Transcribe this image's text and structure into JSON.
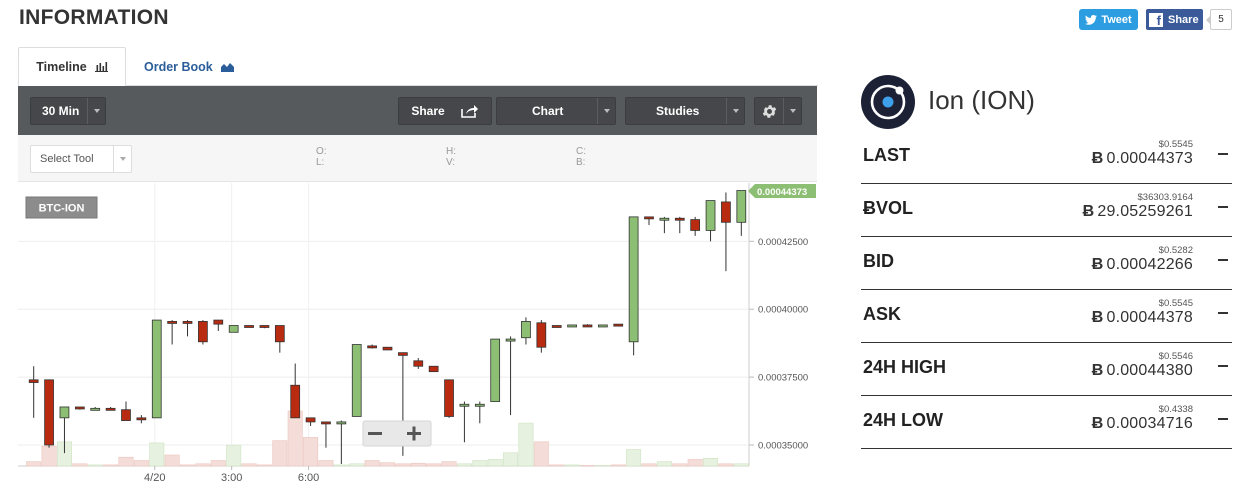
{
  "header": {
    "title": "INFORMATION"
  },
  "social": {
    "tweet_label": "Tweet",
    "share_label": "Share",
    "share_count": "5"
  },
  "tabs": [
    {
      "label": "Timeline",
      "icon": "bar-chart-icon",
      "active": true
    },
    {
      "label": "Order Book",
      "icon": "area-chart-icon",
      "active": false
    }
  ],
  "toolbar": {
    "interval": "30 Min",
    "share": "Share",
    "chart": "Chart",
    "studies": "Studies"
  },
  "tools": {
    "select_tool": "Select Tool",
    "ohlc_labels": [
      "O:",
      "L:",
      "H:",
      "V:",
      "C:",
      "B:"
    ]
  },
  "chart_data": {
    "type": "candlestick",
    "pair_label": "BTC-ION",
    "last_price_label": "0.00044373",
    "y_ticks": [
      "0.00042500",
      "0.00040000",
      "0.00037500",
      "0.00035000"
    ],
    "x_ticks": [
      "4/20",
      "3:00",
      "6:00"
    ],
    "ylim": [
      0.000343,
      0.000445
    ],
    "candles": [
      {
        "o": 0.000374,
        "h": 0.000379,
        "l": 0.00036,
        "c": 0.000373
      },
      {
        "o": 0.000374,
        "h": 0.000374,
        "l": 0.000349,
        "c": 0.00035
      },
      {
        "o": 0.00036,
        "h": 0.000364,
        "l": 0.000347,
        "c": 0.000364
      },
      {
        "o": 0.000364,
        "h": 0.000364,
        "l": 0.000363,
        "c": 0.0003635
      },
      {
        "o": 0.0003635,
        "h": 0.000364,
        "l": 0.000363,
        "c": 0.0003635
      },
      {
        "o": 0.0003635,
        "h": 0.000364,
        "l": 0.000363,
        "c": 0.000363
      },
      {
        "o": 0.000363,
        "h": 0.000366,
        "l": 0.000359,
        "c": 0.000359
      },
      {
        "o": 0.00036,
        "h": 0.000361,
        "l": 0.000358,
        "c": 0.0003595
      },
      {
        "o": 0.00036,
        "h": 0.000396,
        "l": 0.00036,
        "c": 0.000396
      },
      {
        "o": 0.0003955,
        "h": 0.000396,
        "l": 0.000387,
        "c": 0.000395
      },
      {
        "o": 0.0003955,
        "h": 0.000396,
        "l": 0.00039,
        "c": 0.000395
      },
      {
        "o": 0.0003955,
        "h": 0.000396,
        "l": 0.000387,
        "c": 0.000388
      },
      {
        "o": 0.000396,
        "h": 0.000396,
        "l": 0.000392,
        "c": 0.0003945
      },
      {
        "o": 0.0003915,
        "h": 0.000394,
        "l": 0.0003915,
        "c": 0.000394
      },
      {
        "o": 0.000394,
        "h": 0.000394,
        "l": 0.0003935,
        "c": 0.0003937
      },
      {
        "o": 0.000394,
        "h": 0.000394,
        "l": 0.000393,
        "c": 0.0003935
      },
      {
        "o": 0.000394,
        "h": 0.000394,
        "l": 0.000384,
        "c": 0.000388
      },
      {
        "o": 0.000372,
        "h": 0.00038,
        "l": 0.00036,
        "c": 0.00036
      },
      {
        "o": 0.00036,
        "h": 0.00036,
        "l": 0.000357,
        "c": 0.0003585
      },
      {
        "o": 0.0003585,
        "h": 0.0003585,
        "l": 0.000349,
        "c": 0.000358
      },
      {
        "o": 0.000358,
        "h": 0.000359,
        "l": 0.000343,
        "c": 0.0003585
      },
      {
        "o": 0.0003605,
        "h": 0.000387,
        "l": 0.0003605,
        "c": 0.000387
      },
      {
        "o": 0.0003865,
        "h": 0.000387,
        "l": 0.0003855,
        "c": 0.000386
      },
      {
        "o": 0.000386,
        "h": 0.000386,
        "l": 0.000385,
        "c": 0.000385
      },
      {
        "o": 0.000384,
        "h": 0.000384,
        "l": 0.000346,
        "c": 0.000383
      },
      {
        "o": 0.000381,
        "h": 0.000382,
        "l": 0.000378,
        "c": 0.000379
      },
      {
        "o": 0.000379,
        "h": 0.000379,
        "l": 0.000377,
        "c": 0.000377
      },
      {
        "o": 0.000374,
        "h": 0.000374,
        "l": 0.00036,
        "c": 0.0003605
      },
      {
        "o": 0.000365,
        "h": 0.000366,
        "l": 0.000351,
        "c": 0.000365
      },
      {
        "o": 0.000365,
        "h": 0.000366,
        "l": 0.000358,
        "c": 0.000365
      },
      {
        "o": 0.000366,
        "h": 0.000389,
        "l": 0.000366,
        "c": 0.000389
      },
      {
        "o": 0.000389,
        "h": 0.00039,
        "l": 0.000361,
        "c": 0.000389
      },
      {
        "o": 0.0003895,
        "h": 0.000397,
        "l": 0.000387,
        "c": 0.0003955
      },
      {
        "o": 0.000395,
        "h": 0.000396,
        "l": 0.000384,
        "c": 0.000386
      },
      {
        "o": 0.000394,
        "h": 0.000394,
        "l": 0.0003935,
        "c": 0.0003935
      },
      {
        "o": 0.000394,
        "h": 0.000394,
        "l": 0.000394,
        "c": 0.0003942
      },
      {
        "o": 0.0003942,
        "h": 0.0003945,
        "l": 0.000394,
        "c": 0.000394
      },
      {
        "o": 0.000394,
        "h": 0.000394,
        "l": 0.000394,
        "c": 0.0003942
      },
      {
        "o": 0.0003945,
        "h": 0.0003945,
        "l": 0.000394,
        "c": 0.0003942
      },
      {
        "o": 0.000388,
        "h": 0.000434,
        "l": 0.000383,
        "c": 0.000434
      },
      {
        "o": 0.000434,
        "h": 0.000434,
        "l": 0.000431,
        "c": 0.0004335
      },
      {
        "o": 0.0004335,
        "h": 0.000434,
        "l": 0.000428,
        "c": 0.0004335
      },
      {
        "o": 0.0004335,
        "h": 0.000434,
        "l": 0.000428,
        "c": 0.000433
      },
      {
        "o": 0.000433,
        "h": 0.000434,
        "l": 0.000427,
        "c": 0.000429
      },
      {
        "o": 0.000429,
        "h": 0.00044,
        "l": 0.000425,
        "c": 0.00044
      },
      {
        "o": 0.0004395,
        "h": 0.000443,
        "l": 0.000414,
        "c": 0.000432
      },
      {
        "o": 0.000432,
        "h": 0.0004437,
        "l": 0.000427,
        "c": 0.0004437
      }
    ],
    "volume": [
      0.08,
      0.36,
      0.44,
      0.04,
      0.02,
      0.02,
      0.16,
      0.1,
      0.42,
      0.2,
      0.02,
      0.04,
      0.1,
      0.38,
      0.04,
      0.02,
      0.46,
      1.0,
      0.52,
      0.1,
      0.02,
      0.04,
      0.1,
      0.06,
      0.04,
      0.05,
      0.04,
      0.08,
      0.04,
      0.1,
      0.12,
      0.24,
      0.78,
      0.44,
      0.02,
      0.02,
      0.01,
      0.01,
      0.02,
      0.3,
      0.04,
      0.08,
      0.04,
      0.12,
      0.14,
      0.04,
      0.04
    ]
  },
  "coin": {
    "name": "Ion (ION)",
    "btc_symbol": "Ƀ",
    "stats": [
      {
        "label": "LAST",
        "usd": "$0.5545",
        "btc": "0.00044373"
      },
      {
        "label": "ɃVOL",
        "usd": "$36303.9164",
        "btc": "29.05259261"
      },
      {
        "label": "BID",
        "usd": "$0.5282",
        "btc": "0.00042266"
      },
      {
        "label": "ASK",
        "usd": "$0.5545",
        "btc": "0.00044378"
      },
      {
        "label": "24H HIGH",
        "usd": "$0.5546",
        "btc": "0.00044380"
      },
      {
        "label": "24H LOW",
        "usd": "$0.4338",
        "btc": "0.00034716"
      }
    ]
  },
  "colors": {
    "up": "#8cbf73",
    "down": "#b82b10",
    "toolbar": "#575a5c",
    "link": "#2a5d9a"
  }
}
